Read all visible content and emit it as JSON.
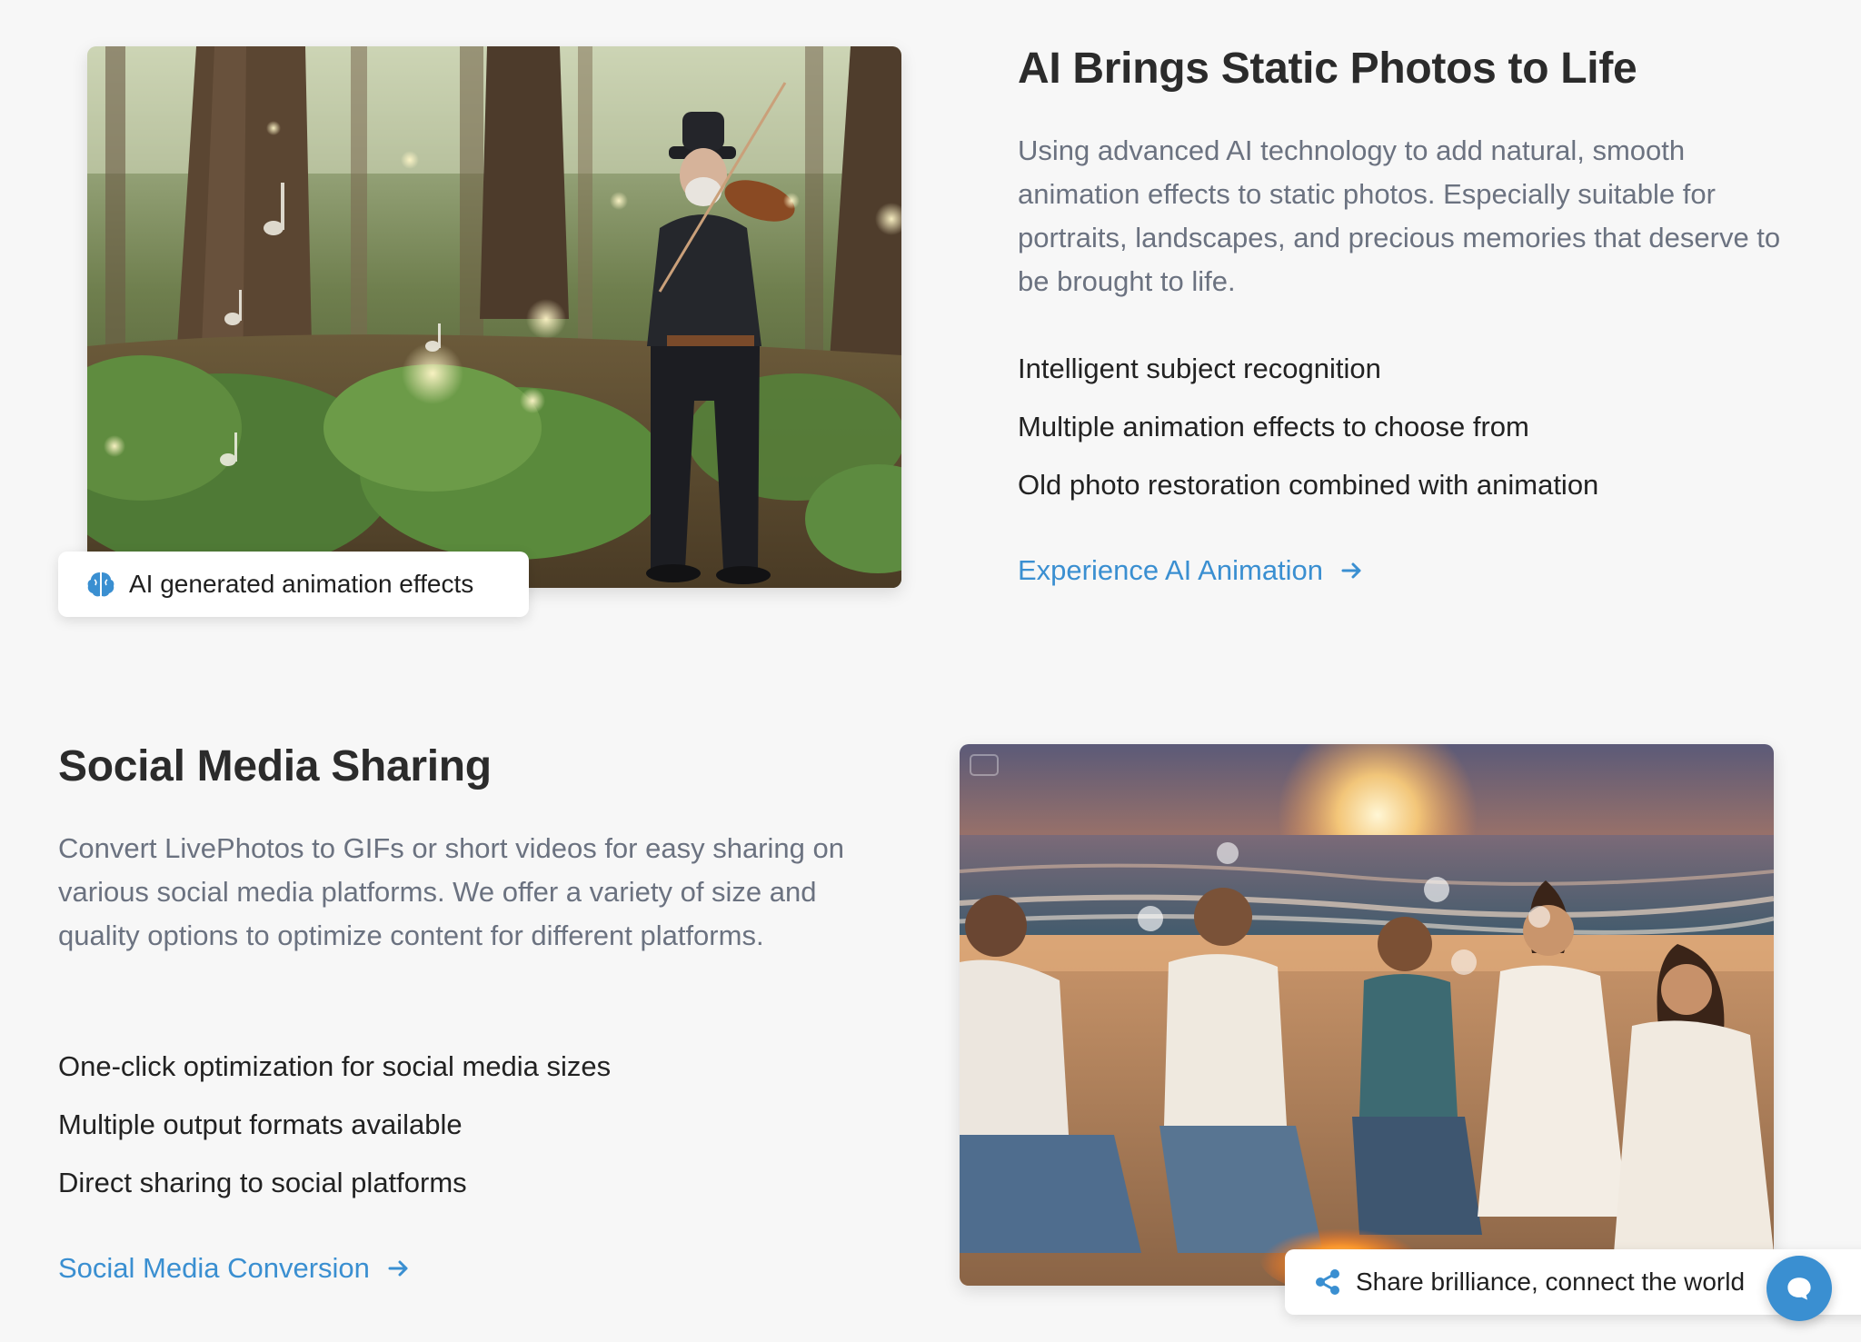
{
  "colors": {
    "background": "#f7f7f7",
    "accent": "#3a8fd1",
    "body_text": "#6b7280",
    "heading_text": "#2b2b2b"
  },
  "section_ai": {
    "title": "AI Brings Static Photos to Life",
    "description": "Using advanced AI technology to add natural, smooth animation effects to static photos. Especially suitable for portraits, landscapes, and precious memories that deserve to be brought to life.",
    "features": [
      "Intelligent subject recognition",
      "Multiple animation effects to choose from",
      "Old photo restoration combined with animation"
    ],
    "link_label": "Experience AI Animation",
    "image_caption": "AI generated animation effects",
    "caption_icon": "brain-icon",
    "link_icon": "arrow-right-icon"
  },
  "section_social": {
    "title": "Social Media Sharing",
    "description": "Convert LivePhotos to GIFs or short videos for easy sharing on various social media platforms. We offer a variety of size and quality options to optimize content for different platforms.",
    "features": [
      "One-click optimization for social media sizes",
      "Multiple output formats available",
      "Direct sharing to social platforms"
    ],
    "link_label": "Social Media Conversion",
    "image_caption": "Share brilliance, connect the world",
    "caption_icon": "share-icon",
    "link_icon": "arrow-right-icon"
  },
  "chat": {
    "icon": "chat-bubble-icon"
  }
}
